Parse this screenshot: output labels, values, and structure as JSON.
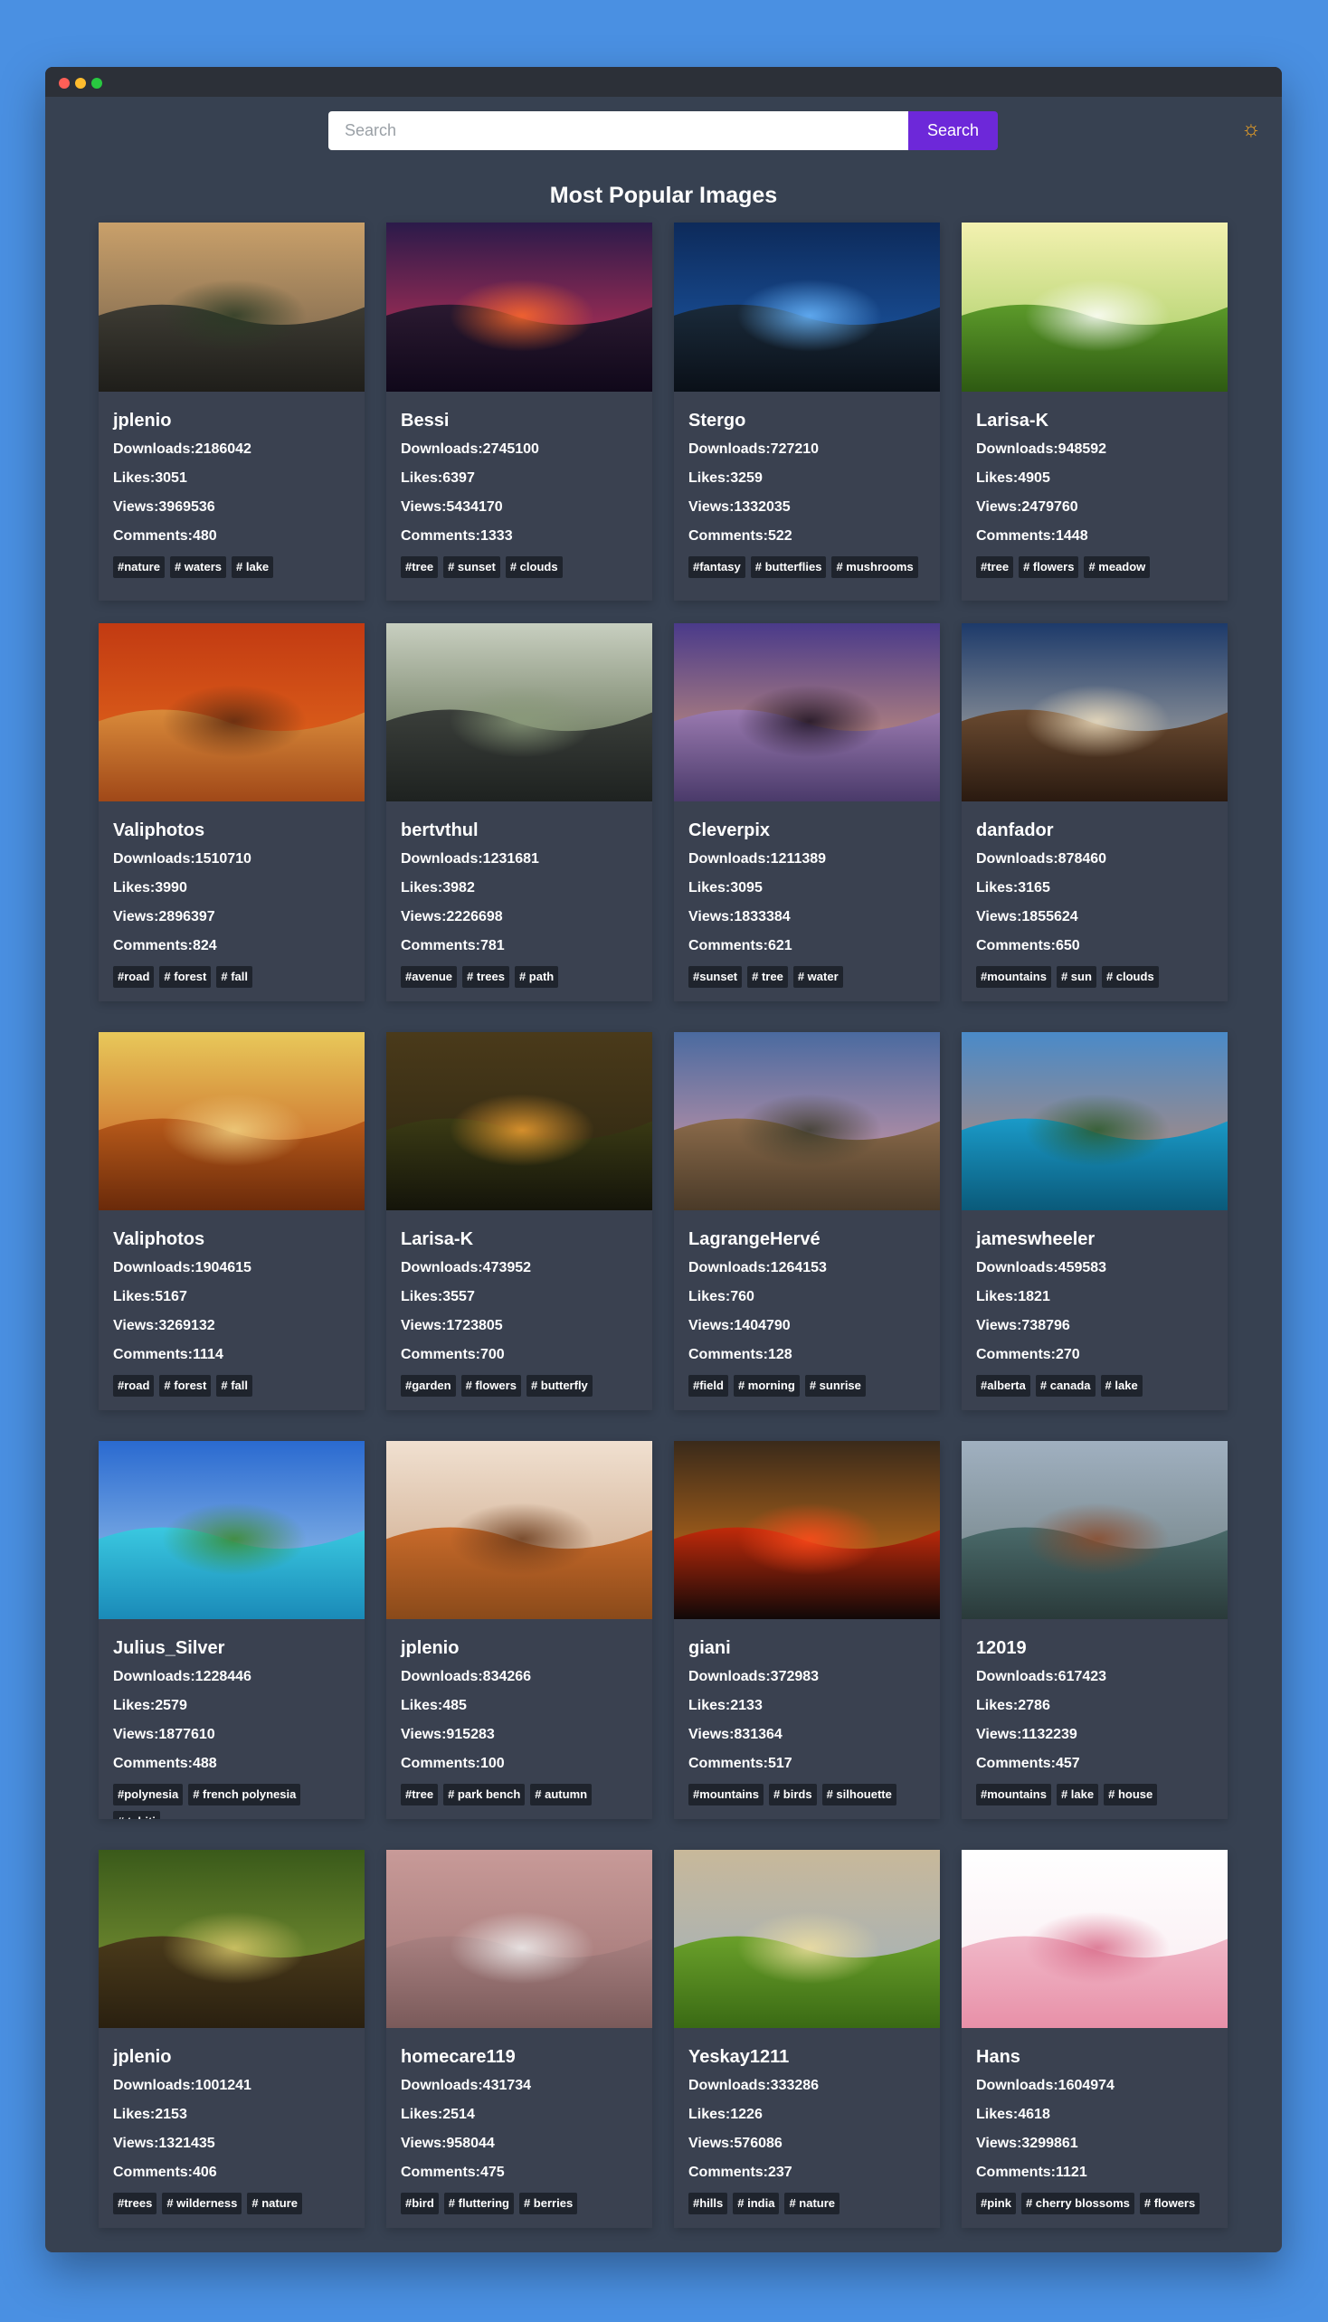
{
  "search": {
    "placeholder": "Search",
    "button_label": "Search"
  },
  "theme_icon": "☼",
  "heading": "Most Popular Images",
  "labels": {
    "downloads": "Downloads:",
    "likes": "Likes:",
    "views": "Views:",
    "comments": "Comments:"
  },
  "cards": [
    {
      "user": "jplenio",
      "downloads": "2186042",
      "likes": "3051",
      "views": "3969536",
      "comments": "480",
      "tags": [
        "#nature",
        "# waters",
        "# lake"
      ],
      "img": "lake-mountain-sunset"
    },
    {
      "user": "Bessi",
      "downloads": "2745100",
      "likes": "6397",
      "views": "5434170",
      "comments": "1333",
      "tags": [
        "#tree",
        "# sunset",
        "# clouds"
      ],
      "img": "tree-red-sky"
    },
    {
      "user": "Stergo",
      "downloads": "727210",
      "likes": "3259",
      "views": "1332035",
      "comments": "522",
      "tags": [
        "#fantasy",
        "# butterflies",
        "# mushrooms"
      ],
      "img": "blue-butterflies"
    },
    {
      "user": "Larisa-K",
      "downloads": "948592",
      "likes": "4905",
      "views": "2479760",
      "comments": "1448",
      "tags": [
        "#tree",
        "# flowers",
        "# meadow"
      ],
      "img": "sunny-meadow"
    },
    {
      "user": "Valiphotos",
      "downloads": "1510710",
      "likes": "3990",
      "views": "2896397",
      "comments": "824",
      "tags": [
        "#road",
        "# forest",
        "# fall"
      ],
      "img": "autumn-road"
    },
    {
      "user": "bertvthul",
      "downloads": "1231681",
      "likes": "3982",
      "views": "2226698",
      "comments": "781",
      "tags": [
        "#avenue",
        "# trees",
        "# path"
      ],
      "img": "forest-path"
    },
    {
      "user": "Cleverpix",
      "downloads": "1211389",
      "likes": "3095",
      "views": "1833384",
      "comments": "621",
      "tags": [
        "#sunset",
        "# tree",
        "# water"
      ],
      "img": "lone-tree-lake"
    },
    {
      "user": "danfador",
      "downloads": "878460",
      "likes": "3165",
      "views": "1855624",
      "comments": "650",
      "tags": [
        "#mountains",
        "# sun",
        "# clouds"
      ],
      "img": "mountain-clouds"
    },
    {
      "user": "Valiphotos",
      "downloads": "1904615",
      "likes": "5167",
      "views": "3269132",
      "comments": "1114",
      "tags": [
        "#road",
        "# forest",
        "# fall"
      ],
      "img": "autumn-forest"
    },
    {
      "user": "Larisa-K",
      "downloads": "473952",
      "likes": "3557",
      "views": "1723805",
      "comments": "700",
      "tags": [
        "#garden",
        "# flowers",
        "# butterfly"
      ],
      "img": "orange-flowers"
    },
    {
      "user": "LagrangeHervé",
      "downloads": "1264153",
      "likes": "760",
      "views": "1404790",
      "comments": "128",
      "tags": [
        "#field",
        "# morning",
        "# sunrise"
      ],
      "img": "tree-field"
    },
    {
      "user": "jameswheeler",
      "downloads": "459583",
      "likes": "1821",
      "views": "738796",
      "comments": "270",
      "tags": [
        "#alberta",
        "# canada",
        "# lake"
      ],
      "img": "moraine-lake"
    },
    {
      "user": "Julius_Silver",
      "downloads": "1228446",
      "likes": "2579",
      "views": "1877610",
      "comments": "488",
      "tags": [
        "#polynesia",
        "# french polynesia",
        "# tahiti"
      ],
      "img": "tropical-island"
    },
    {
      "user": "jplenio",
      "downloads": "834266",
      "likes": "485",
      "views": "915283",
      "comments": "100",
      "tags": [
        "#tree",
        "# park bench",
        "# autumn"
      ],
      "img": "tree-bench"
    },
    {
      "user": "giani",
      "downloads": "372983",
      "likes": "2133",
      "views": "831364",
      "comments": "517",
      "tags": [
        "#mountains",
        "# birds",
        "# silhouette"
      ],
      "img": "red-sunset"
    },
    {
      "user": "12019",
      "downloads": "617423",
      "likes": "2786",
      "views": "1132239",
      "comments": "457",
      "tags": [
        "#mountains",
        "# lake",
        "# house"
      ],
      "img": "lake-house"
    },
    {
      "user": "jplenio",
      "downloads": "1001241",
      "likes": "2153",
      "views": "1321435",
      "comments": "406",
      "tags": [
        "#trees",
        "# wilderness",
        "# nature"
      ],
      "img": "big-tree"
    },
    {
      "user": "homecare119",
      "downloads": "431734",
      "likes": "2514",
      "views": "958044",
      "comments": "475",
      "tags": [
        "#bird",
        "# fluttering",
        "# berries"
      ],
      "img": "bird-flying"
    },
    {
      "user": "Yeskay1211",
      "downloads": "333286",
      "likes": "1226",
      "views": "576086",
      "comments": "237",
      "tags": [
        "#hills",
        "# india",
        "# nature"
      ],
      "img": "green-hills"
    },
    {
      "user": "Hans",
      "downloads": "1604974",
      "likes": "4618",
      "views": "3299861",
      "comments": "1121",
      "tags": [
        "#pink",
        "# cherry blossoms",
        "# flowers"
      ],
      "img": "cherry-blossoms"
    }
  ]
}
